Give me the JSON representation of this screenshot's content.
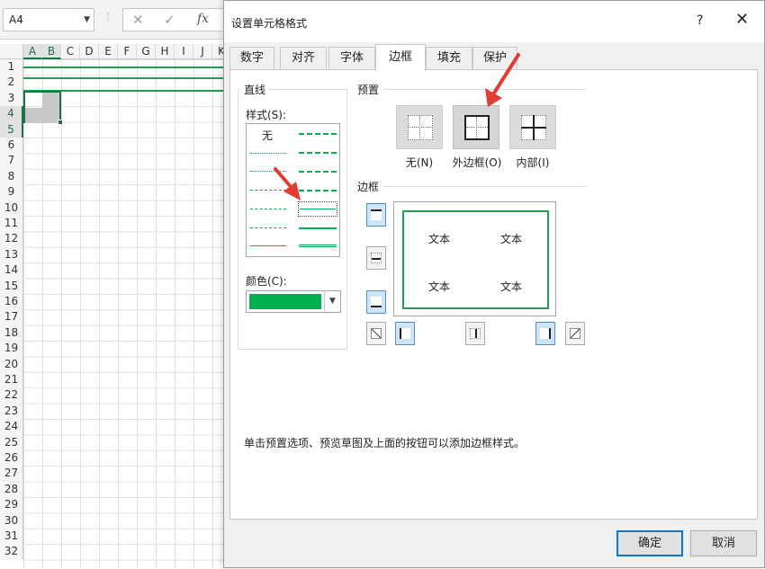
{
  "excel": {
    "name_box": "A4",
    "fx_buttons": {
      "cancel": "✕",
      "enter": "✓",
      "fx": "fx"
    },
    "columns": [
      "A",
      "B",
      "C",
      "D",
      "E",
      "F",
      "G",
      "H",
      "I",
      "J",
      "K"
    ],
    "rows": [
      "1",
      "2",
      "3",
      "4",
      "5",
      "6",
      "7",
      "8",
      "9",
      "10",
      "11",
      "12",
      "13",
      "14",
      "15",
      "16",
      "17",
      "18",
      "19",
      "20",
      "21",
      "22",
      "23",
      "24",
      "25",
      "26",
      "27",
      "28",
      "29",
      "30",
      "31",
      "32"
    ]
  },
  "dialog": {
    "title": "设置单元格格式",
    "help": "?",
    "close": "✕",
    "tabs": [
      "数字",
      "对齐",
      "字体",
      "边框",
      "填充",
      "保护"
    ],
    "active_tab": "边框",
    "line_group": "直线",
    "style_label": "样式(S):",
    "style_none": "无",
    "color_label": "颜色(C):",
    "color_value": "#00b050",
    "presets_group": "预置",
    "presets": [
      "无(N)",
      "外边框(O)",
      "内部(I)"
    ],
    "border_group": "边框",
    "preview_text": [
      "文本",
      "文本",
      "文本",
      "文本"
    ],
    "hint": "单击预置选项、预览草图及上面的按钮可以添加边框样式。",
    "ok": "确定",
    "cancel": "取消"
  },
  "colors": {
    "accent_green": "#00b050",
    "annotation_red": "#e03c31",
    "focus_blue": "#0078d7"
  }
}
